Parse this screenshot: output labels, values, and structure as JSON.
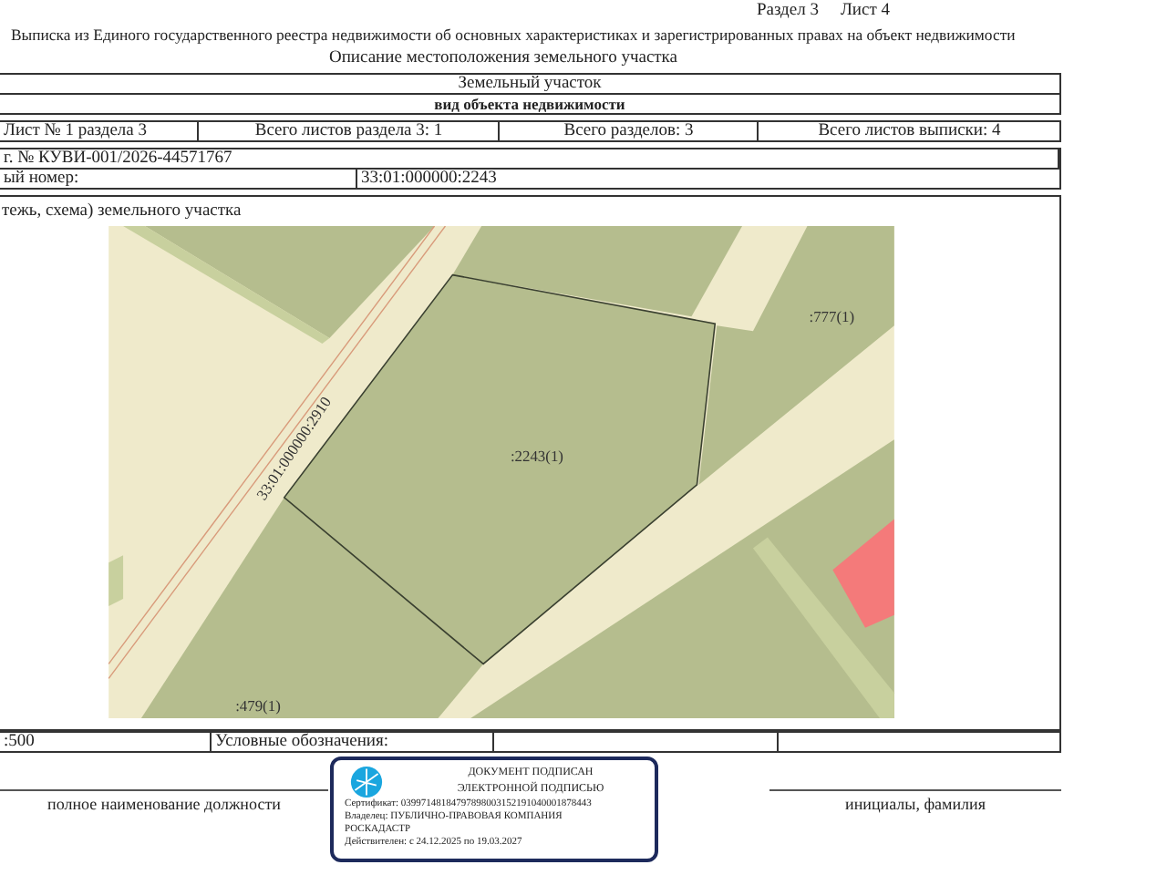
{
  "header": {
    "section": "Раздел 3",
    "sheet": "Лист 4"
  },
  "title": "Выписка из Единого государственного реестра недвижимости об основных характеристиках и зарегистрированных правах на объект недвижимости",
  "subtitle": "Описание местоположения земельного участка",
  "object": {
    "value": "Земельный участок",
    "caption": "вид объекта недвижимости"
  },
  "sheet_info": [
    "Лист № 1 раздела 3",
    "Всего листов раздела 3: 1",
    "Всего разделов: 3",
    "Всего листов выписки: 4"
  ],
  "registry_number": "г. № КУВИ-001/2026-44571767",
  "cadastral": {
    "label": "ый номер:",
    "value": "33:01:000000:2243"
  },
  "plan": {
    "caption": "тежь, схема) земельного участка",
    "map_labels": [
      {
        "kind": "road",
        "text": "33:01:000000:2910"
      },
      {
        "kind": "parcel",
        "text": ":2243(1)"
      },
      {
        "kind": "neighbor_ne",
        "text": ":777(1)"
      },
      {
        "kind": "neighbor_sw",
        "text": ":479(1)"
      }
    ]
  },
  "scale": ":500",
  "legend_label": "Условные обозначения:",
  "footer": {
    "position": "полное наименование должности",
    "name": "инициалы, фамилия"
  },
  "stamp": {
    "title": [
      "ДОКУМЕНТ ПОДПИСАН",
      "ЭЛЕКТРОННОЙ ПОДПИСЬЮ"
    ],
    "certificate": "Сертификат: 03997148184797898003152191040001878443",
    "owner": [
      "Владелец: ПУБЛИЧНО-ПРАВОВАЯ КОМПАНИЯ",
      "РОСКАДАСТР"
    ],
    "validity": "Действителен: с 24.12.2025 по 19.03.2027"
  }
}
